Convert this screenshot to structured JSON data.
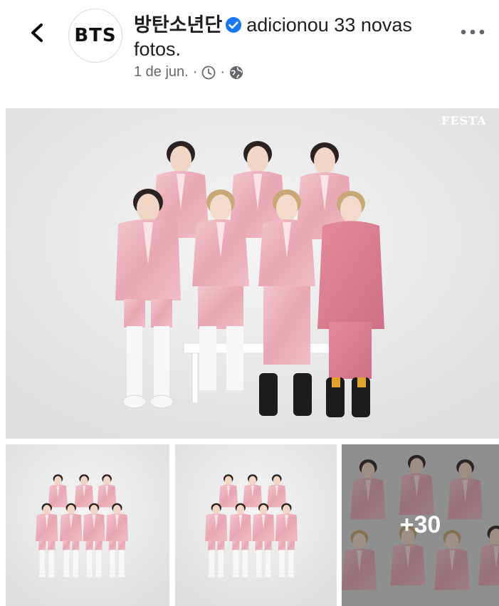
{
  "post": {
    "avatar_text": "BTS",
    "author": "방탄소년단",
    "action": "adicionou 33 novas fotos.",
    "date": "1 de jun.",
    "separator": "·"
  },
  "photos": {
    "watermark": "FESTA",
    "more_count": "+30"
  },
  "icons": {
    "back": "chevron-left-icon",
    "verified": "verified-badge-icon",
    "clock": "clock-icon",
    "globe": "globe-icon",
    "more": "more-horizontal-icon"
  },
  "colors": {
    "verified": "#1877f2",
    "meta_text": "#65676b",
    "suit_pink": "#eab2bc",
    "background_studio": "#ececec"
  }
}
